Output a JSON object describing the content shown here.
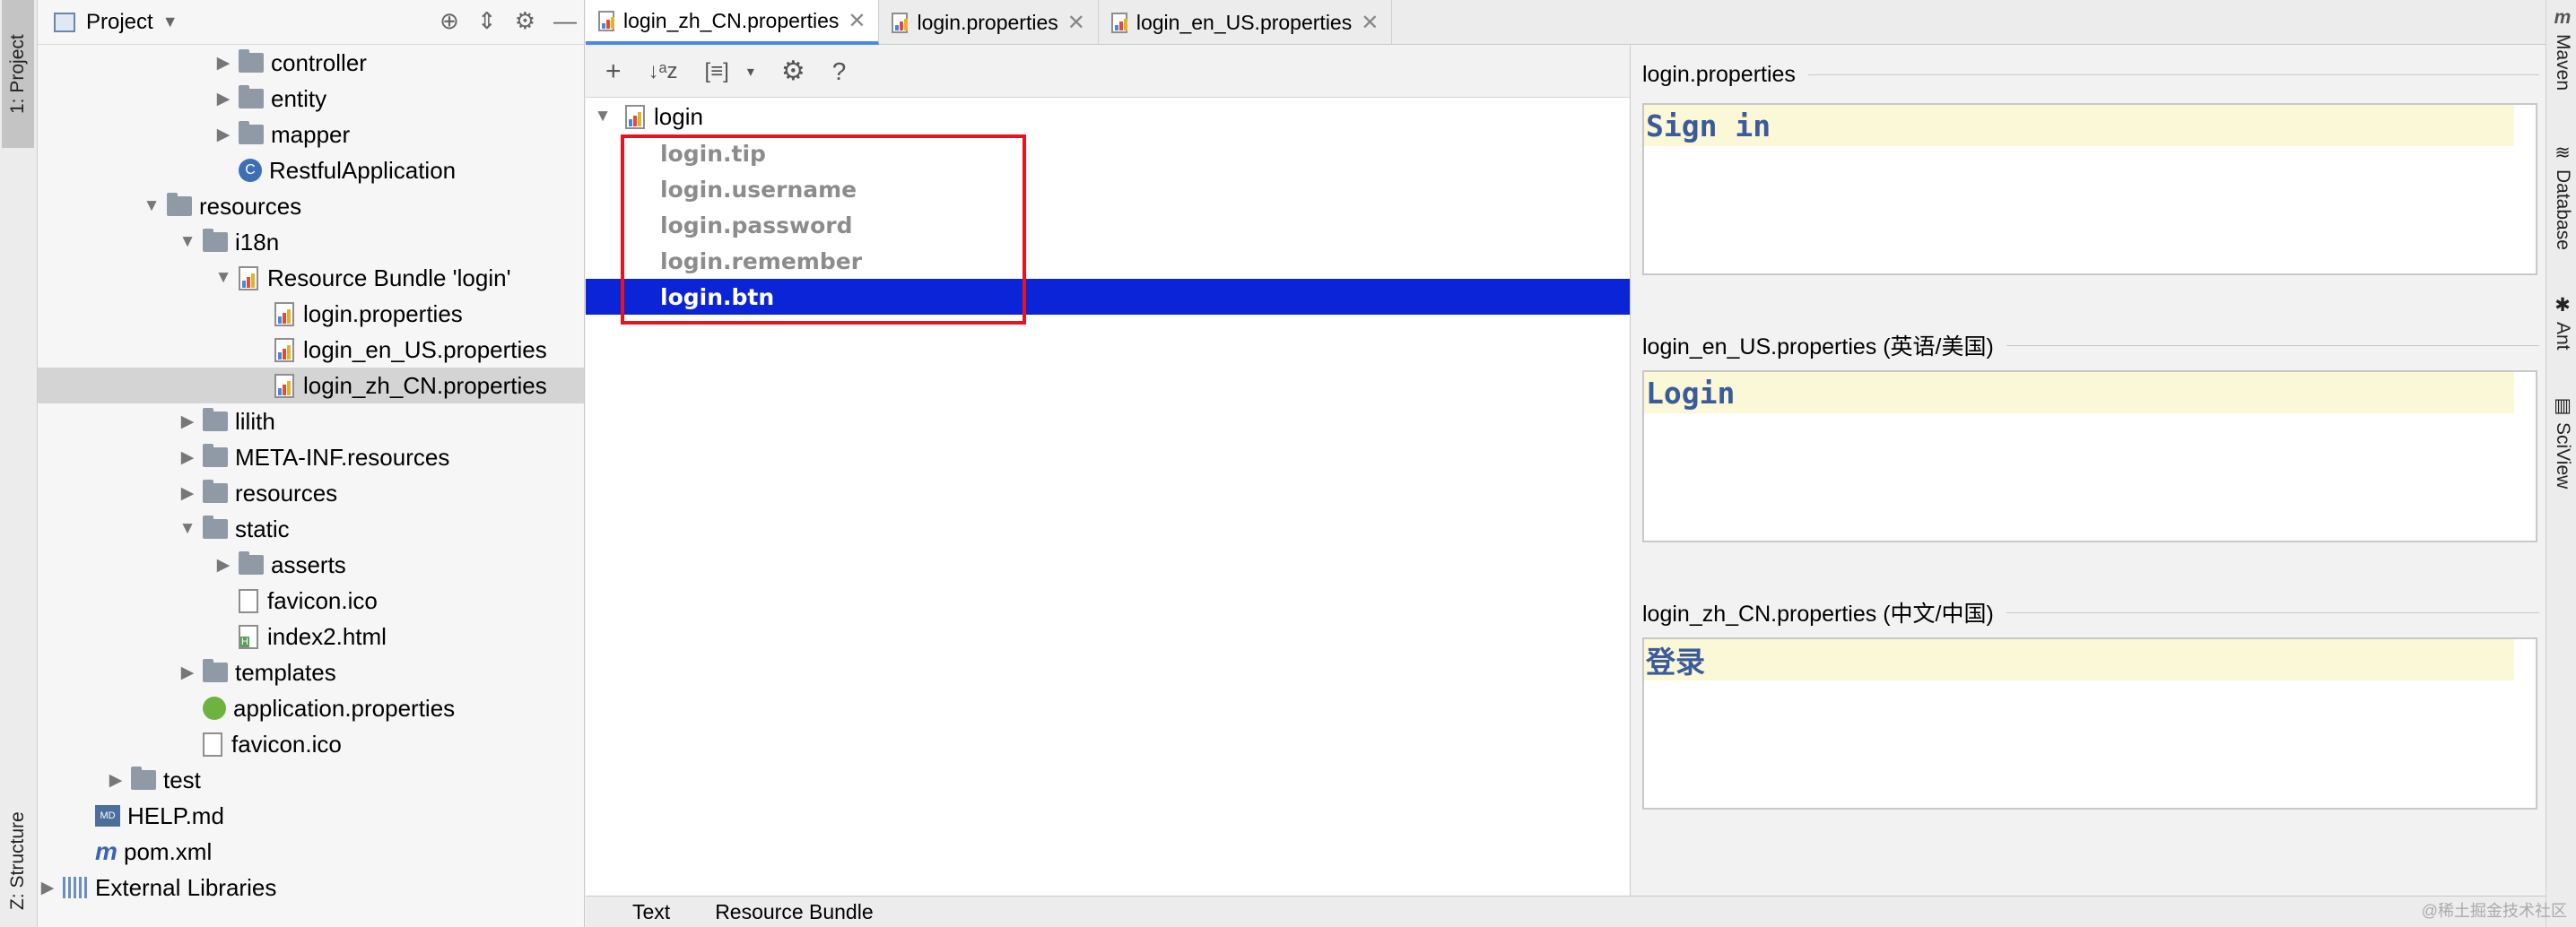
{
  "left_stripe": {
    "project_label": "1: Project",
    "structure_label": "Z: Structure"
  },
  "project": {
    "title": "Project",
    "tree": [
      {
        "label": "controller",
        "indent": 3,
        "arrow": "▶",
        "icon": "folder-icon"
      },
      {
        "label": "entity",
        "indent": 3,
        "arrow": "▶",
        "icon": "folder-icon"
      },
      {
        "label": "mapper",
        "indent": 3,
        "arrow": "▶",
        "icon": "folder-icon"
      },
      {
        "label": "RestfulApplication",
        "indent": 3,
        "arrow": "",
        "icon": "spring-class-icon"
      },
      {
        "label": "resources",
        "indent": 1,
        "arrow": "▼",
        "icon": "folder-icon"
      },
      {
        "label": "i18n",
        "indent": 2,
        "arrow": "▼",
        "icon": "folder-icon"
      },
      {
        "label": "Resource Bundle 'login'",
        "indent": 3,
        "arrow": "▼",
        "icon": "resource-bundle-icon"
      },
      {
        "label": "login.properties",
        "indent": 4,
        "arrow": "",
        "icon": "properties-file-icon"
      },
      {
        "label": "login_en_US.properties",
        "indent": 4,
        "arrow": "",
        "icon": "properties-file-icon"
      },
      {
        "label": "login_zh_CN.properties",
        "indent": 4,
        "arrow": "",
        "icon": "properties-file-icon",
        "selected": true
      },
      {
        "label": "lilith",
        "indent": 2,
        "arrow": "▶",
        "icon": "folder-icon"
      },
      {
        "label": "META-INF.resources",
        "indent": 2,
        "arrow": "▶",
        "icon": "folder-icon"
      },
      {
        "label": "resources",
        "indent": 2,
        "arrow": "▶",
        "icon": "folder-icon"
      },
      {
        "label": "static",
        "indent": 2,
        "arrow": "▼",
        "icon": "folder-icon"
      },
      {
        "label": "asserts",
        "indent": 3,
        "arrow": "▶",
        "icon": "folder-icon"
      },
      {
        "label": "favicon.ico",
        "indent": 3,
        "arrow": "",
        "icon": "file-icon"
      },
      {
        "label": "index2.html",
        "indent": 3,
        "arrow": "",
        "icon": "html-file-icon"
      },
      {
        "label": "templates",
        "indent": 2,
        "arrow": "▶",
        "icon": "folder-icon"
      },
      {
        "label": "application.properties",
        "indent": 2,
        "arrow": "",
        "icon": "spring-properties-icon"
      },
      {
        "label": "favicon.ico",
        "indent": 2,
        "arrow": "",
        "icon": "file-icon"
      },
      {
        "label": "test",
        "indent": 0,
        "arrow": "▶",
        "icon": "folder-icon"
      },
      {
        "label": "HELP.md",
        "indent": -1,
        "arrow": "",
        "icon": "markdown-file-icon"
      },
      {
        "label": "pom.xml",
        "indent": -1,
        "arrow": "",
        "icon": "maven-file-icon"
      },
      {
        "label": "External Libraries",
        "indent": -2,
        "arrow": "▶",
        "icon": "libraries-icon"
      }
    ]
  },
  "tabs": [
    {
      "label": "login_zh_CN.properties",
      "active": true
    },
    {
      "label": "login.properties",
      "active": false
    },
    {
      "label": "login_en_US.properties",
      "active": false
    }
  ],
  "bundle": {
    "root": "login",
    "keys": [
      "login.tip",
      "login.username",
      "login.password",
      "login.remember",
      "login.btn"
    ],
    "selected_index": 4
  },
  "values": [
    {
      "file": "login.properties",
      "value": "Sign in"
    },
    {
      "file": "login_en_US.properties (英语/美国)",
      "value": "Login"
    },
    {
      "file": "login_zh_CN.properties (中文/中国)",
      "value": "登录"
    }
  ],
  "bottom_tabs": [
    "Text",
    "Resource Bundle"
  ],
  "right_stripe": [
    "Maven",
    "Database",
    "Ant",
    "SciView"
  ],
  "watermark": "@稀土掘金技术社区",
  "colors": {
    "selection": "#0b24d8",
    "highlight_box": "#e8141c",
    "value_bg": "#fbf8d7",
    "active_tab_underline": "#4a88e7"
  }
}
